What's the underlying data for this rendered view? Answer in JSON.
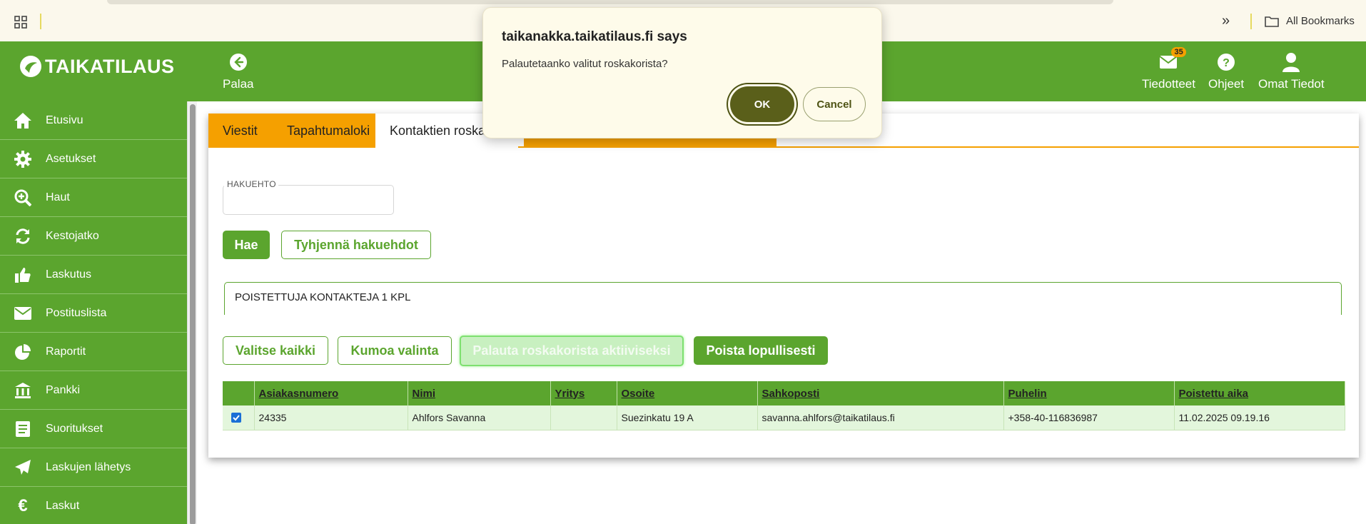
{
  "browser": {
    "bookmarks_label": "All Bookmarks",
    "overflow_label": "»"
  },
  "header": {
    "logo_text": "TAIKATILAUS",
    "back_label": "Palaa",
    "notifications_label": "Tiedotteet",
    "notifications_count": "35",
    "help_label": "Ohjeet",
    "profile_label": "Omat Tiedot"
  },
  "sidebar": {
    "items": [
      {
        "label": "Etusivu",
        "icon": "home-icon"
      },
      {
        "label": "Asetukset",
        "icon": "gear-icon"
      },
      {
        "label": "Haut",
        "icon": "zoom-in-icon"
      },
      {
        "label": "Kestojatko",
        "icon": "refresh-icon"
      },
      {
        "label": "Laskutus",
        "icon": "thumbs-up-icon"
      },
      {
        "label": "Postituslista",
        "icon": "envelope-icon"
      },
      {
        "label": "Raportit",
        "icon": "pie-chart-icon"
      },
      {
        "label": "Pankki",
        "icon": "bank-icon"
      },
      {
        "label": "Suoritukset",
        "icon": "book-icon"
      },
      {
        "label": "Laskujen lähetys",
        "icon": "paper-plane-icon"
      },
      {
        "label": "Laskut",
        "icon": "euro-icon"
      }
    ]
  },
  "tabs": [
    {
      "label": "Viestit"
    },
    {
      "label": "Tapahtumaloki"
    },
    {
      "label": "Kontaktien roska"
    }
  ],
  "search": {
    "field_label": "HAKUEHTO",
    "value": "",
    "search_button": "Hae",
    "clear_button": "Tyhjennä hakuehdot"
  },
  "info": {
    "deleted_count_text": "POISTETTUJA KONTAKTEJA 1 KPL"
  },
  "actions": {
    "select_all": "Valitse kaikki",
    "deselect": "Kumoa valinta",
    "restore": "Palauta roskakorista aktiiviseksi",
    "delete_permanently": "Poista lopullisesti"
  },
  "table": {
    "headers": [
      "Asiakasnumero",
      "Nimi",
      "Yritys",
      "Osoite",
      "Sahkoposti",
      "Puhelin",
      "Poistettu aika"
    ],
    "rows": [
      {
        "checked": true,
        "customer_number": "24335",
        "name": "Ahlfors Savanna",
        "company": "",
        "address": "Suezinkatu 19 A",
        "email": "savanna.ahlfors@taikatilaus.fi",
        "phone": "+358-40-116836987",
        "deleted_time": "11.02.2025 09.19.16"
      }
    ]
  },
  "dialog": {
    "title": "taikanakka.taikatilaus.fi says",
    "message": "Palautetaanko valitut roskakorista?",
    "ok_label": "OK",
    "cancel_label": "Cancel"
  },
  "colors": {
    "brand_green": "#5ba52e",
    "tab_orange": "#f5a000",
    "row_green": "#e3f6dc",
    "dialog_bg": "#fefbea",
    "dialog_ok": "#5a5f1a"
  }
}
